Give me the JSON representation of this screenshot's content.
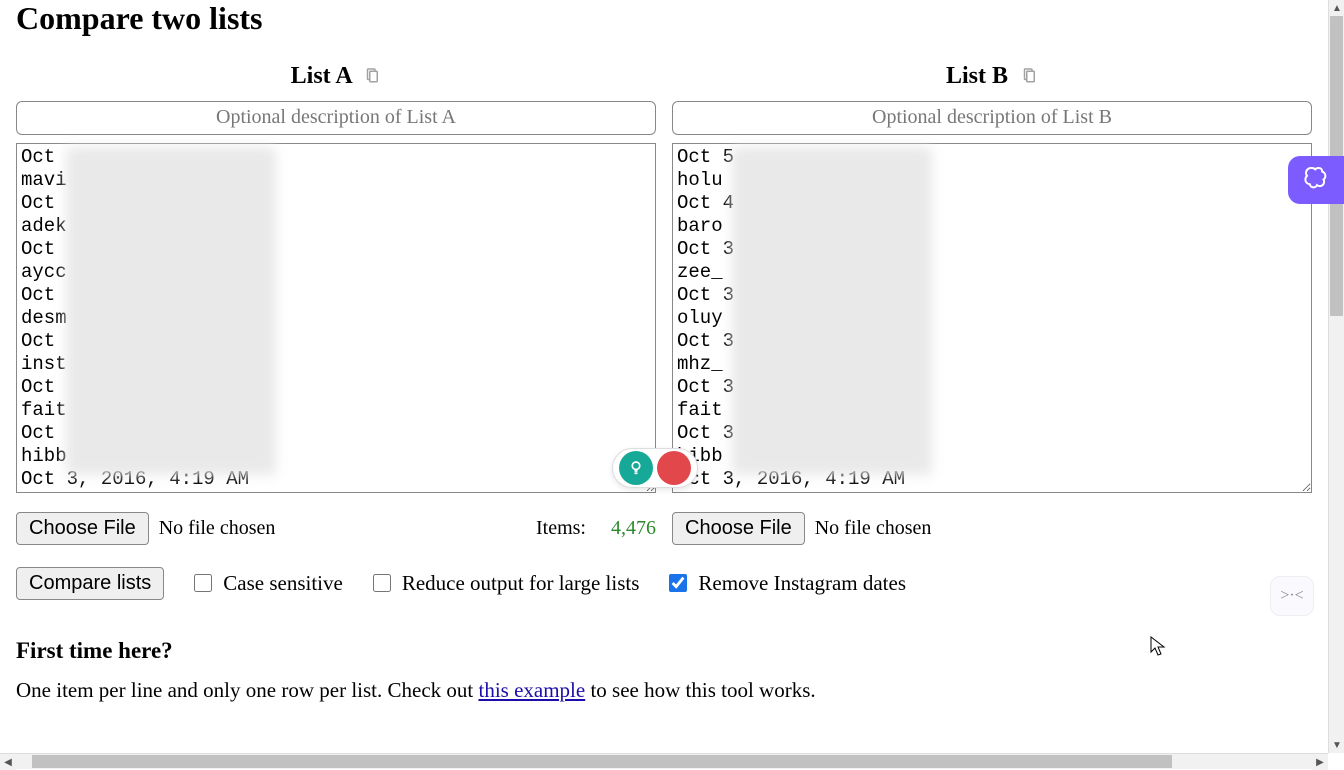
{
  "page_title": "Compare two lists",
  "listA": {
    "header": "List A",
    "desc_placeholder": "Optional description of List A",
    "content": "Oct\nmavi\nOct\nadek\nOct\naycc\nOct\ndesm\nOct\ninst\nOct\nfait\nOct\nhibb\nOct 3, 2016, 4:19 AM",
    "file_button": "Choose File",
    "file_status": "No file chosen",
    "items_label": "Items:",
    "items_count": "4,476"
  },
  "listB": {
    "header": "List B",
    "desc_placeholder": "Optional description of List B",
    "content": "Oct 5\nholu\nOct 4\nbaro\nOct 3\nzee_\nOct 3\noluy\nOct 3\nmhz_\nOct 3\nfait\nOct 3\nhibb\nOct 3, 2016, 4:19 AM",
    "file_button": "Choose File",
    "file_status": "No file chosen"
  },
  "controls": {
    "compare_label": "Compare lists",
    "case_sensitive_label": "Case sensitive",
    "case_sensitive_checked": false,
    "reduce_label": "Reduce output for large lists",
    "reduce_checked": false,
    "remove_ig_label": "Remove Instagram dates",
    "remove_ig_checked": true
  },
  "help": {
    "heading": "First time here?",
    "text_before_link": "One item per line and only one row per list. Check out ",
    "link_text": "this example",
    "text_after_link": " to see how this tool works."
  }
}
